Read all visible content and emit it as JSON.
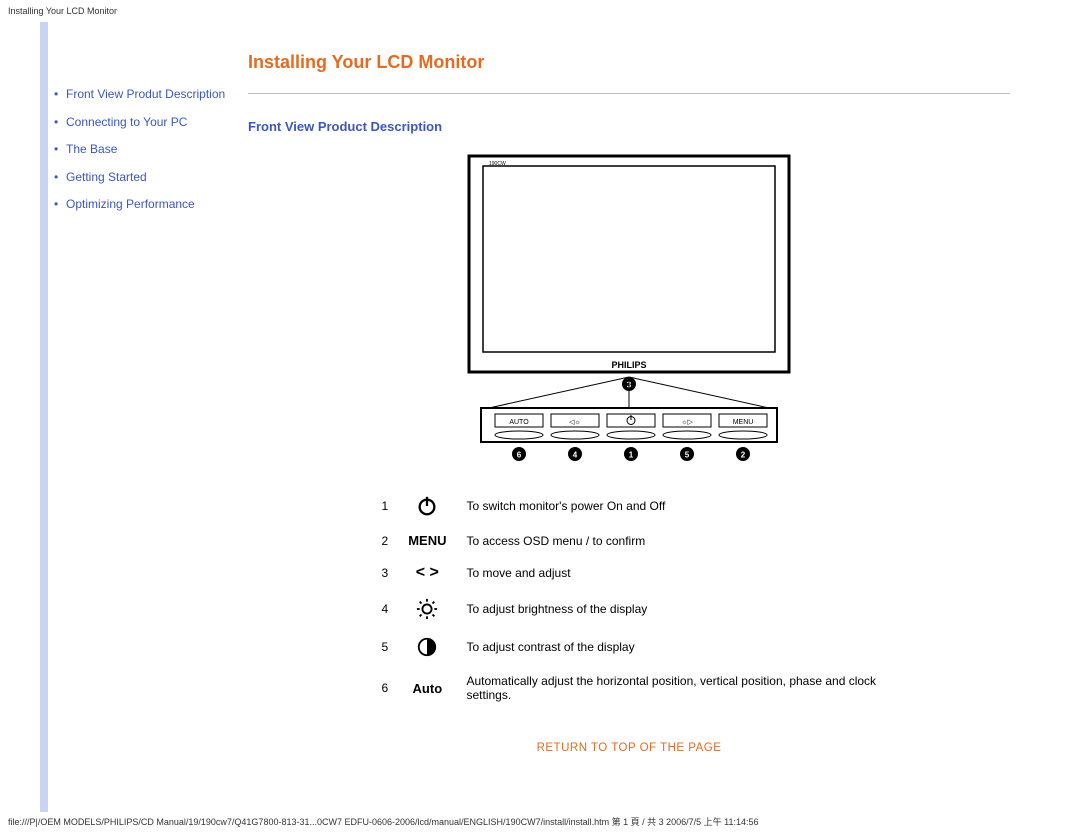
{
  "page": {
    "header_text": "Installing Your LCD Monitor",
    "footer_text": "file:///P|/OEM MODELS/PHILIPS/CD Manual/19/190cw7/Q41G7800-813-31...0CW7 EDFU-0606-2006/lcd/manual/ENGLISH/190CW7/install/install.htm 第 1 頁 / 共 3 2006/7/5 上午 11:14:56"
  },
  "sidebar": {
    "items": [
      {
        "label": "Front View Produt Description"
      },
      {
        "label": "Connecting to Your PC"
      },
      {
        "label": "The Base"
      },
      {
        "label": "Getting Started"
      },
      {
        "label": "Optimizing Performance"
      }
    ]
  },
  "main": {
    "title": "Installing Your LCD Monitor",
    "section_heading": "Front View Product Description",
    "diagram": {
      "brand_small": "190CW",
      "brand_text": "PHILIPS",
      "button_labels": [
        "AUTO",
        "◁☼",
        "⏻",
        "☼▷",
        "MENU"
      ],
      "bottom_badges": [
        "6",
        "4",
        "1",
        "5",
        "2"
      ],
      "top_badge": "3"
    },
    "features": [
      {
        "num": "1",
        "icon": "power",
        "desc": "To switch monitor's power On and Off"
      },
      {
        "num": "2",
        "icon": "menu",
        "desc": "To access OSD menu / to confirm"
      },
      {
        "num": "3",
        "icon": "arrows",
        "desc": "To move and adjust"
      },
      {
        "num": "4",
        "icon": "brightness",
        "desc": "To adjust brightness of the display"
      },
      {
        "num": "5",
        "icon": "contrast",
        "desc": "To adjust contrast of the display"
      },
      {
        "num": "6",
        "icon": "auto",
        "desc": "Automatically adjust the horizontal position, vertical position, phase and clock settings."
      }
    ],
    "icon_text": {
      "menu": "MENU",
      "arrows": "<  >",
      "auto": "Auto"
    },
    "return_link": "RETURN TO TOP OF THE PAGE"
  }
}
